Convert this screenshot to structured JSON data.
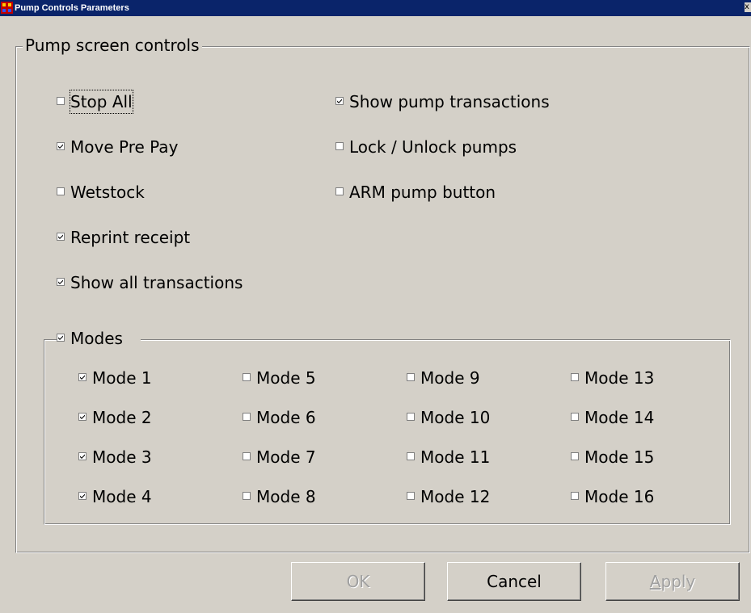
{
  "window": {
    "title": "Pump Controls Parameters",
    "app_icon": "app-grid-icon",
    "close_glyph": "x"
  },
  "group": {
    "title": "Pump screen controls"
  },
  "left_options": [
    {
      "label": "Stop All",
      "checked": false
    },
    {
      "label": "Move Pre Pay",
      "checked": true
    },
    {
      "label": "Wetstock",
      "checked": false
    },
    {
      "label": "Reprint receipt",
      "checked": true
    },
    {
      "label": "Show all transactions",
      "checked": true
    }
  ],
  "right_options": [
    {
      "label": "Show pump transactions",
      "checked": true
    },
    {
      "label": "Lock / Unlock pumps",
      "checked": false
    },
    {
      "label": "ARM pump button",
      "checked": false
    }
  ],
  "modes": {
    "label": "Modes",
    "checked": true,
    "items": [
      {
        "label": "Mode 1",
        "checked": true
      },
      {
        "label": "Mode 2",
        "checked": true
      },
      {
        "label": "Mode 3",
        "checked": true
      },
      {
        "label": "Mode 4",
        "checked": true
      },
      {
        "label": "Mode 5",
        "checked": false
      },
      {
        "label": "Mode 6",
        "checked": false
      },
      {
        "label": "Mode 7",
        "checked": false
      },
      {
        "label": "Mode 8",
        "checked": false
      },
      {
        "label": "Mode 9",
        "checked": false
      },
      {
        "label": "Mode 10",
        "checked": false
      },
      {
        "label": "Mode 11",
        "checked": false
      },
      {
        "label": "Mode 12",
        "checked": false
      },
      {
        "label": "Mode 13",
        "checked": false
      },
      {
        "label": "Mode 14",
        "checked": false
      },
      {
        "label": "Mode 15",
        "checked": false
      },
      {
        "label": "Mode 16",
        "checked": false
      }
    ]
  },
  "buttons": {
    "ok": {
      "label": "OK",
      "enabled": false
    },
    "cancel": {
      "label": "Cancel",
      "enabled": true
    },
    "apply": {
      "label": "Apply",
      "enabled": false,
      "mnemonic": "A"
    }
  },
  "colors": {
    "titlebar": "#0a246a",
    "face": "#d4d0c8",
    "disabled_text": "#a0a0a0"
  }
}
